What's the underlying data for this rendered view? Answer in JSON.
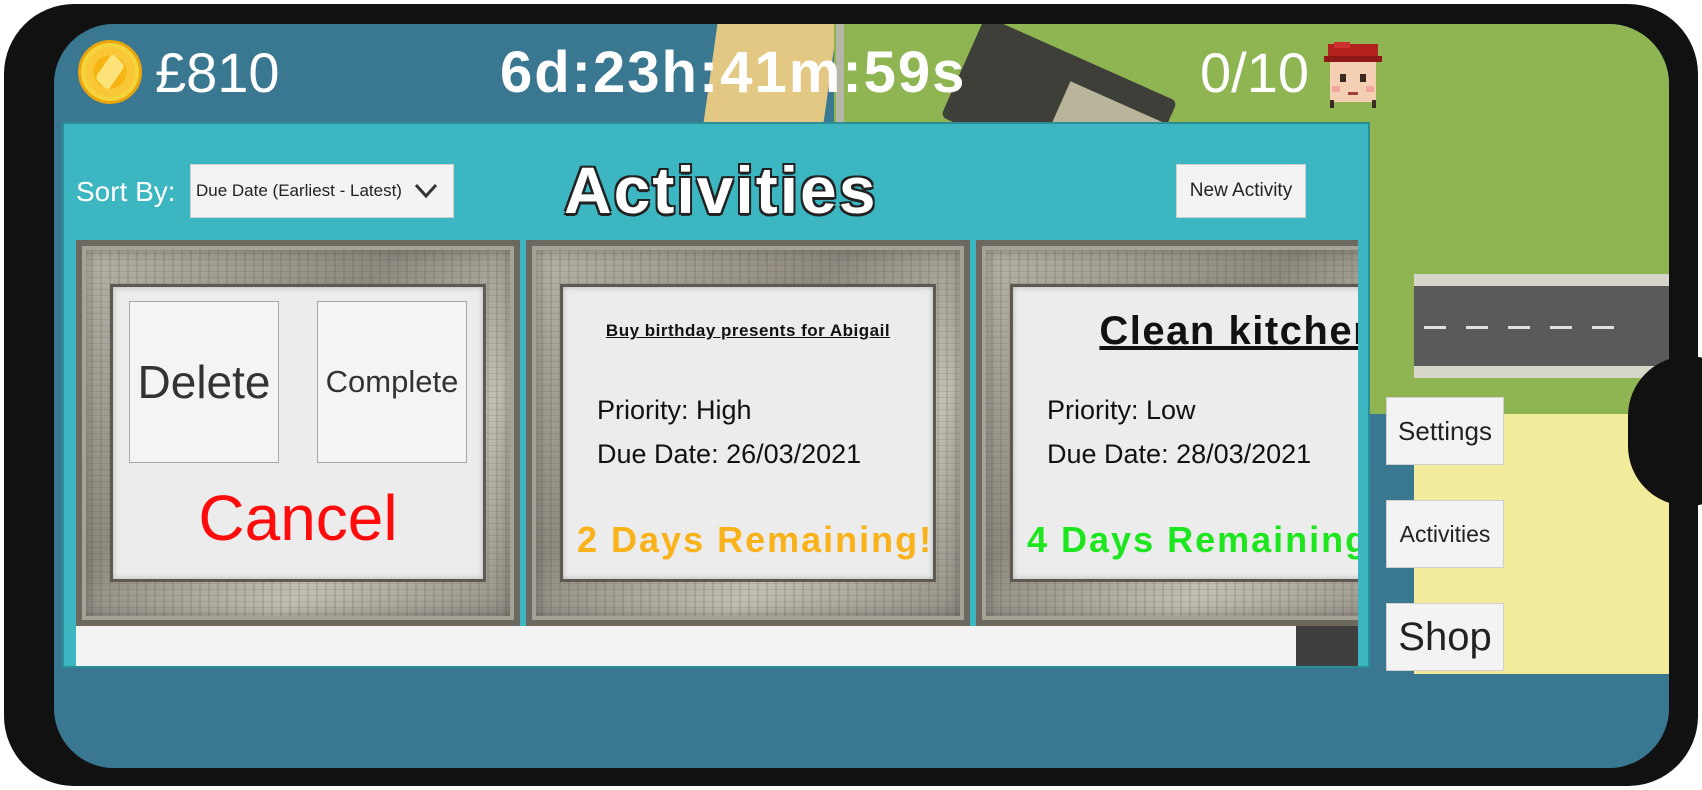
{
  "hud": {
    "money": "£810",
    "timer": "6d:23h:41m:59s",
    "staff_count": "0/10"
  },
  "panel": {
    "title": "Activities",
    "sort_label": "Sort By:",
    "sort_value": "Due Date (Earliest - Latest)",
    "new_activity_label": "New Activity"
  },
  "cards": {
    "action_card": {
      "delete_label": "Delete",
      "complete_label": "Complete",
      "cancel_label": "Cancel"
    },
    "activities": [
      {
        "title": "Buy birthday presents for Abigail",
        "priority": "Priority: High",
        "due": "Due Date: 26/03/2021",
        "remaining": "2 Days Remaining!",
        "remaining_color": "#f9b21a"
      },
      {
        "title": "Clean kitchen",
        "priority": "Priority: Low",
        "due": "Due Date: 28/03/2021",
        "remaining": "4 Days Remaining",
        "remaining_color": "#1ee61e"
      }
    ]
  },
  "side_menu": {
    "settings_label": "Settings",
    "activities_label": "Activities",
    "shop_label": "Shop"
  },
  "colors": {
    "panel_bg": "#3cb6c0",
    "cancel_red": "#ff0b0b",
    "coin_gold": "#f7b514"
  },
  "icons": {
    "coin": "coin-icon",
    "avatar": "worker-avatar-icon",
    "dropdown": "chevron-down-icon"
  }
}
